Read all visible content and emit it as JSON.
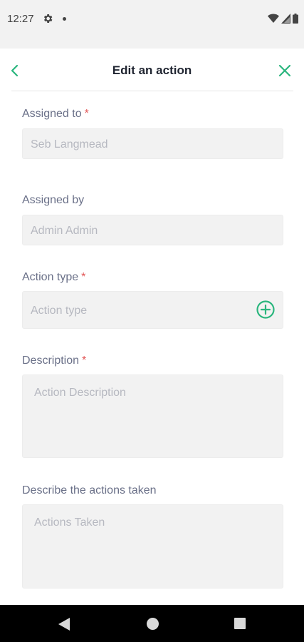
{
  "status_bar": {
    "time": "12:27"
  },
  "header": {
    "title": "Edit an action"
  },
  "form": {
    "assigned_to": {
      "label": "Assigned to",
      "required_mark": "*",
      "value": "Seb Langmead"
    },
    "assigned_by": {
      "label": "Assigned by",
      "value": "Admin Admin"
    },
    "action_type": {
      "label": "Action type",
      "required_mark": "*",
      "placeholder": "Action type"
    },
    "description": {
      "label": "Description",
      "required_mark": "*",
      "placeholder": "Action Description"
    },
    "actions_taken": {
      "label": "Describe the actions taken",
      "placeholder": "Actions Taken"
    }
  },
  "colors": {
    "accent": "#2bb67e",
    "required": "#e25555",
    "label": "#6a7088",
    "field_bg": "#f2f2f2"
  },
  "icons": [
    "settings-icon",
    "wifi-icon",
    "signal-icon",
    "battery-icon",
    "back-chevron-icon",
    "close-icon",
    "add-circle-icon",
    "nav-back-icon",
    "nav-home-icon",
    "nav-recents-icon"
  ]
}
